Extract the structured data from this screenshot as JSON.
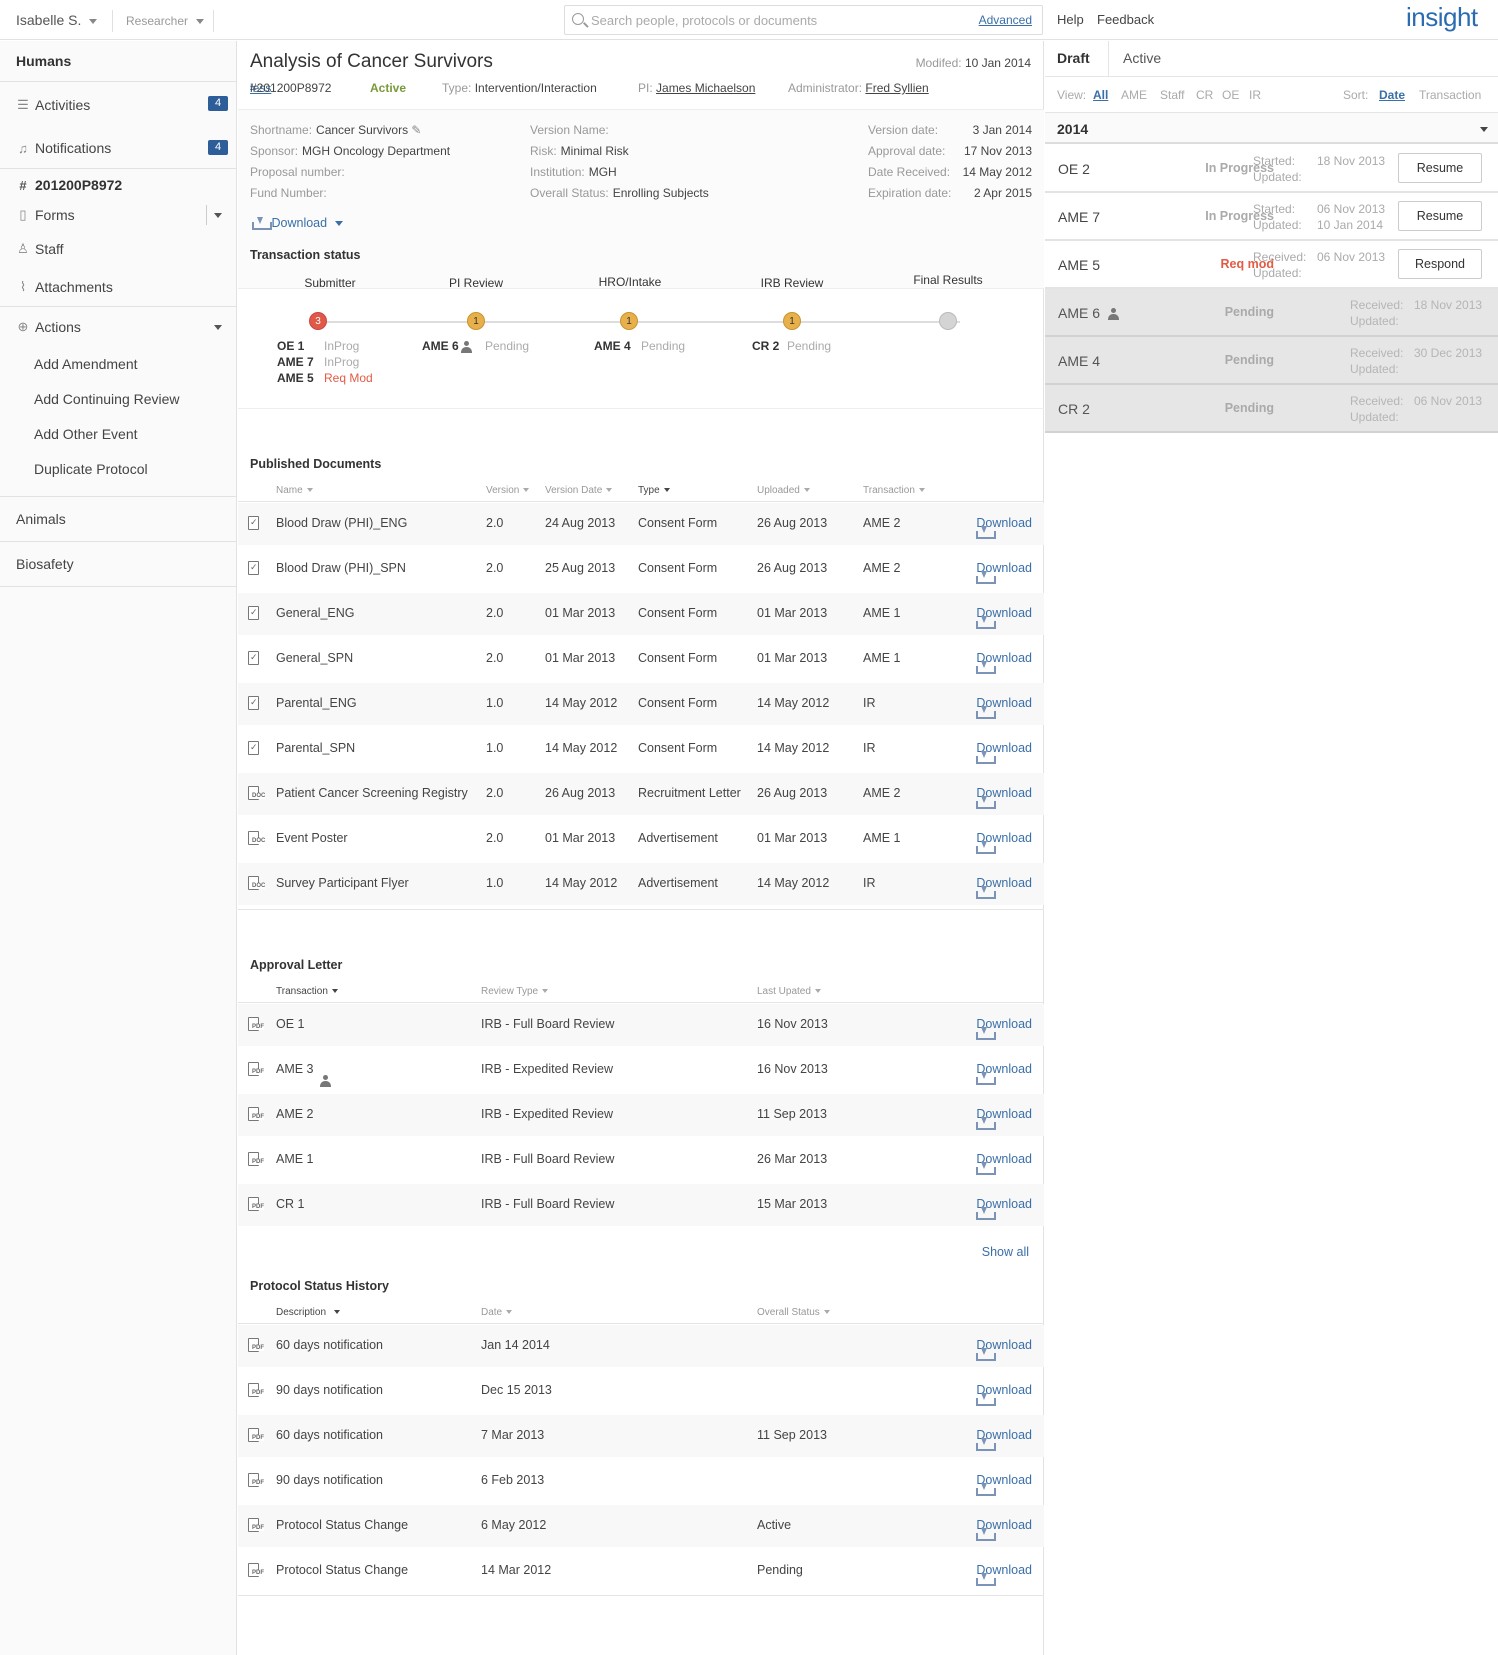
{
  "topbar": {
    "user": "Isabelle S.",
    "role": "Researcher",
    "search_placeholder": "Search people, protocols or documents",
    "advanced": "Advanced",
    "help": "Help",
    "feedback": "Feedback",
    "logo": "insight"
  },
  "sidebar": {
    "humans": "Humans",
    "activities": "Activities",
    "activities_count": "4",
    "notifications": "Notifications",
    "notifications_count": "4",
    "protocol_id": "201200P8972",
    "forms": "Forms",
    "staff": "Staff",
    "attachments": "Attachments",
    "actions": "Actions",
    "action_items": [
      "Add Amendment",
      "Add Continuing Review",
      "Add Other Event",
      "Duplicate Protocol"
    ],
    "animals": "Animals",
    "biosafety": "Biosafety"
  },
  "protocol": {
    "title": "Analysis of Cancer Survivors",
    "modified_label": "Modifed:",
    "modified": "10 Jan 2014",
    "number": "#201200P8972",
    "status": "Active",
    "type_label": "Type:",
    "type": "Intervention/Interaction",
    "pi_label": "PI:",
    "pi": "James Michaelson",
    "admin_label": "Administrator:",
    "admin": "Fred Syllien",
    "less": "less",
    "shortname_label": "Shortname:",
    "shortname": "Cancer Survivors",
    "sponsor_label": "Sponsor:",
    "sponsor": "MGH Oncology Department",
    "proposal_label": "Proposal number:",
    "fund_label": "Fund Number:",
    "version_name_label": "Version Name:",
    "risk_label": "Risk:",
    "risk": "Minimal Risk",
    "institution_label": "Institution:",
    "institution": "MGH",
    "overall_label": "Overall Status:",
    "overall": "Enrolling Subjects",
    "version_date_label": "Version date:",
    "version_date": "3 Jan 2014",
    "approval_label": "Approval date:",
    "approval": "17 Nov 2013",
    "received_label": "Date Received:",
    "received": "14 May 2012",
    "expiration_label": "Expiration date:",
    "expiration": "2 Apr 2015",
    "download": "Download"
  },
  "transaction": {
    "title": "Transaction status",
    "stages": [
      "Submitter",
      "PI Review",
      "HRO/Intake",
      "IRB Review",
      "Final Results"
    ],
    "counts": [
      "3",
      "1",
      "1",
      "1",
      ""
    ],
    "submitter_items": [
      {
        "id": "OE 1",
        "status": "InProg"
      },
      {
        "id": "AME 7",
        "status": "InProg"
      },
      {
        "id": "AME 5",
        "status": "Req Mod"
      }
    ],
    "pi_item": {
      "id": "AME 6",
      "status": "Pending"
    },
    "hro_item": {
      "id": "AME 4",
      "status": "Pending"
    },
    "irb_item": {
      "id": "CR 2",
      "status": "Pending"
    }
  },
  "published": {
    "title": "Published Documents",
    "headers": [
      "Name",
      "Version",
      "Version Date",
      "Type",
      "Uploaded",
      "Transaction"
    ],
    "rows": [
      [
        "Blood Draw (PHI)_ENG",
        "2.0",
        "24 Aug 2013",
        "Consent Form",
        "26 Aug 2013",
        "AME 2"
      ],
      [
        "Blood Draw (PHI)_SPN",
        "2.0",
        "25 Aug 2013",
        "Consent Form",
        "26 Aug 2013",
        "AME 2"
      ],
      [
        "General_ENG",
        "2.0",
        "01 Mar 2013",
        "Consent Form",
        "01 Mar 2013",
        "AME 1"
      ],
      [
        "General_SPN",
        "2.0",
        "01 Mar 2013",
        "Consent Form",
        "01 Mar 2013",
        "AME 1"
      ],
      [
        "Parental_ENG",
        "1.0",
        "14 May 2012",
        "Consent Form",
        "14 May 2012",
        "IR"
      ],
      [
        "Parental_SPN",
        "1.0",
        "14 May 2012",
        "Consent Form",
        "14 May 2012",
        "IR"
      ],
      [
        "Patient Cancer Screening Registry",
        "2.0",
        "26 Aug 2013",
        "Recruitment Letter",
        "26 Aug 2013",
        "AME 2"
      ],
      [
        "Event Poster",
        "2.0",
        "01 Mar 2013",
        "Advertisement",
        "01 Mar 2013",
        "AME 1"
      ],
      [
        "Survey Participant Flyer",
        "1.0",
        "14 May 2012",
        "Advertisement",
        "14 May 2012",
        "IR"
      ]
    ],
    "download": "Download"
  },
  "approval": {
    "title": "Approval Letter",
    "headers": [
      "Transaction",
      "Review Type",
      "Last Upated"
    ],
    "rows": [
      [
        "OE 1",
        "IRB - Full Board Review",
        "16 Nov 2013"
      ],
      [
        "AME 3",
        "IRB - Expedited Review",
        "16 Nov 2013"
      ],
      [
        "AME 2",
        "IRB - Expedited Review",
        "11 Sep 2013"
      ],
      [
        "AME 1",
        "IRB - Full Board Review",
        "26 Mar 2013"
      ],
      [
        "CR 1",
        "IRB - Full Board Review",
        "15 Mar 2013"
      ]
    ],
    "show_all": "Show all"
  },
  "history": {
    "title": "Protocol Status History",
    "headers": [
      "Description",
      "Date",
      "Overall Status"
    ],
    "rows": [
      [
        "60 days notification",
        "Jan 14 2014",
        ""
      ],
      [
        "90 days notification",
        "Dec 15 2013",
        ""
      ],
      [
        "60 days notification",
        "7 Mar 2013",
        "11 Sep 2013"
      ],
      [
        "90 days notification",
        "6 Feb 2013",
        ""
      ],
      [
        "Protocol Status Change",
        "6 May 2012",
        "Active"
      ],
      [
        "Protocol Status Change",
        "14 Mar 2012",
        "Pending"
      ]
    ]
  },
  "right_panel": {
    "tab_draft": "Draft",
    "tab_active": "Active",
    "view_label": "View:",
    "view_options": [
      "All",
      "AME",
      "Staff",
      "CR",
      "OE",
      "IR"
    ],
    "sort_label": "Sort:",
    "sort_options": [
      "Date",
      "Transaction"
    ],
    "year": "2014",
    "items": [
      {
        "name": "OE 2",
        "status": "In Progress",
        "l1": "Started:",
        "d1": "18 Nov 2013",
        "l2": "Updated:",
        "d2": "",
        "button": "Resume"
      },
      {
        "name": "AME 7",
        "status": "In Progress",
        "l1": "Started:",
        "d1": "06 Nov 2013",
        "l2": "Updated:",
        "d2": "10 Jan 2014",
        "button": "Resume"
      },
      {
        "name": "AME 5",
        "status": "Req mod",
        "l1": "Received:",
        "d1": "06 Nov 2013",
        "l2": "Updated:",
        "d2": "",
        "button": "Respond"
      },
      {
        "name": "AME 6",
        "status": "Pending",
        "l1": "Received:",
        "d1": "18 Nov 2013",
        "l2": "Updated:",
        "d2": "",
        "button": ""
      },
      {
        "name": "AME 4",
        "status": "Pending",
        "l1": "Received:",
        "d1": "30 Dec 2013",
        "l2": "Updated:",
        "d2": "",
        "button": ""
      },
      {
        "name": "CR 2",
        "status": "Pending",
        "l1": "Received:",
        "d1": "06 Nov 2013",
        "l2": "Updated:",
        "d2": "",
        "button": ""
      }
    ]
  }
}
